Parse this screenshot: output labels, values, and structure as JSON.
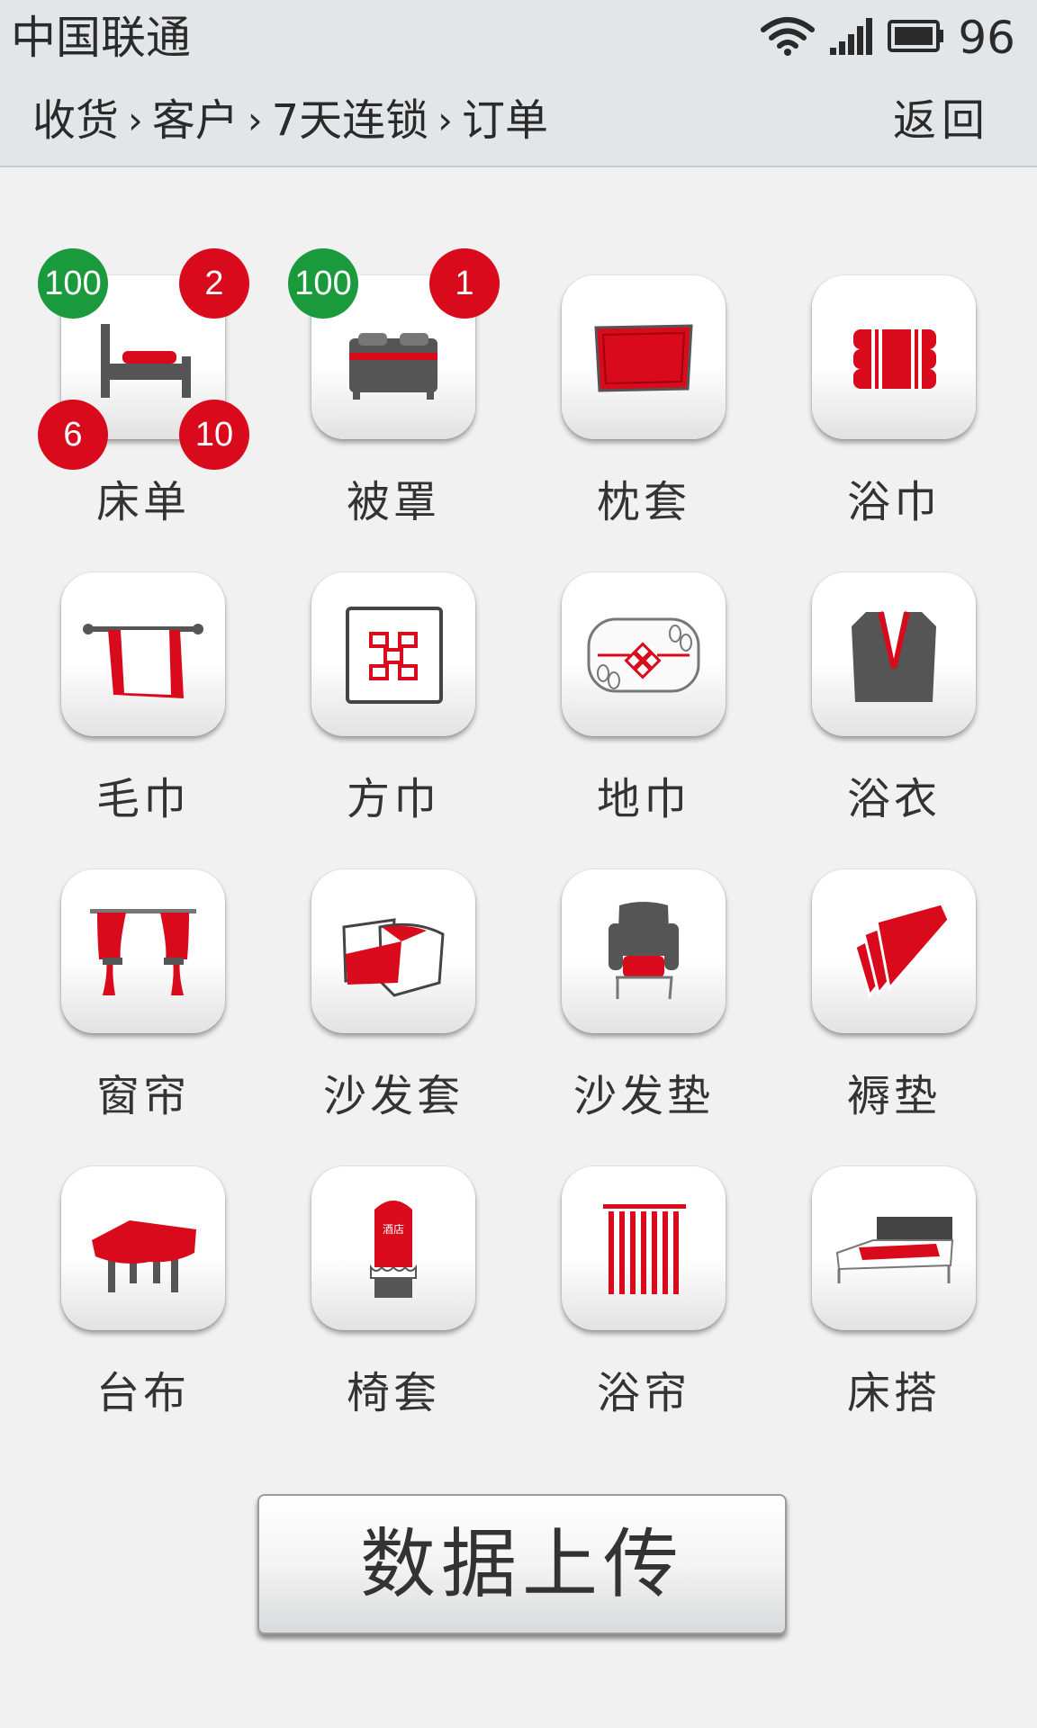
{
  "status_bar": {
    "carrier": "中国联通",
    "battery_level": "96",
    "icons": [
      "wifi-icon",
      "signal-icon",
      "battery-icon"
    ]
  },
  "nav": {
    "breadcrumb": [
      "收货",
      "客户",
      "7天连锁",
      "订单"
    ],
    "back_label": "返回"
  },
  "items": [
    {
      "label": "床单",
      "icon": "single-bed-icon",
      "badges": {
        "top_left": "100",
        "top_right": "2",
        "bottom_left": "6",
        "bottom_right": "10"
      }
    },
    {
      "label": "被罩",
      "icon": "double-bed-icon",
      "badges": {
        "top_left": "100",
        "top_right": "1"
      }
    },
    {
      "label": "枕套",
      "icon": "pillowcase-icon"
    },
    {
      "label": "浴巾",
      "icon": "bath-towel-icon"
    },
    {
      "label": "毛巾",
      "icon": "towel-icon"
    },
    {
      "label": "方巾",
      "icon": "square-towel-icon"
    },
    {
      "label": "地巾",
      "icon": "floor-mat-icon"
    },
    {
      "label": "浴衣",
      "icon": "bathrobe-icon"
    },
    {
      "label": "窗帘",
      "icon": "curtain-icon"
    },
    {
      "label": "沙发套",
      "icon": "sofa-cover-icon"
    },
    {
      "label": "沙发垫",
      "icon": "sofa-cushion-icon"
    },
    {
      "label": "褥垫",
      "icon": "mattress-pad-icon"
    },
    {
      "label": "台布",
      "icon": "tablecloth-icon"
    },
    {
      "label": "椅套",
      "icon": "chair-cover-icon"
    },
    {
      "label": "浴帘",
      "icon": "shower-curtain-icon"
    },
    {
      "label": "床搭",
      "icon": "bed-runner-icon"
    }
  ],
  "chair_cover_text": "酒店",
  "upload_button": "数据上传",
  "colors": {
    "accent_red": "#d90a1c",
    "badge_green": "#1a9a3c",
    "dark_gray": "#4a4a4a"
  }
}
